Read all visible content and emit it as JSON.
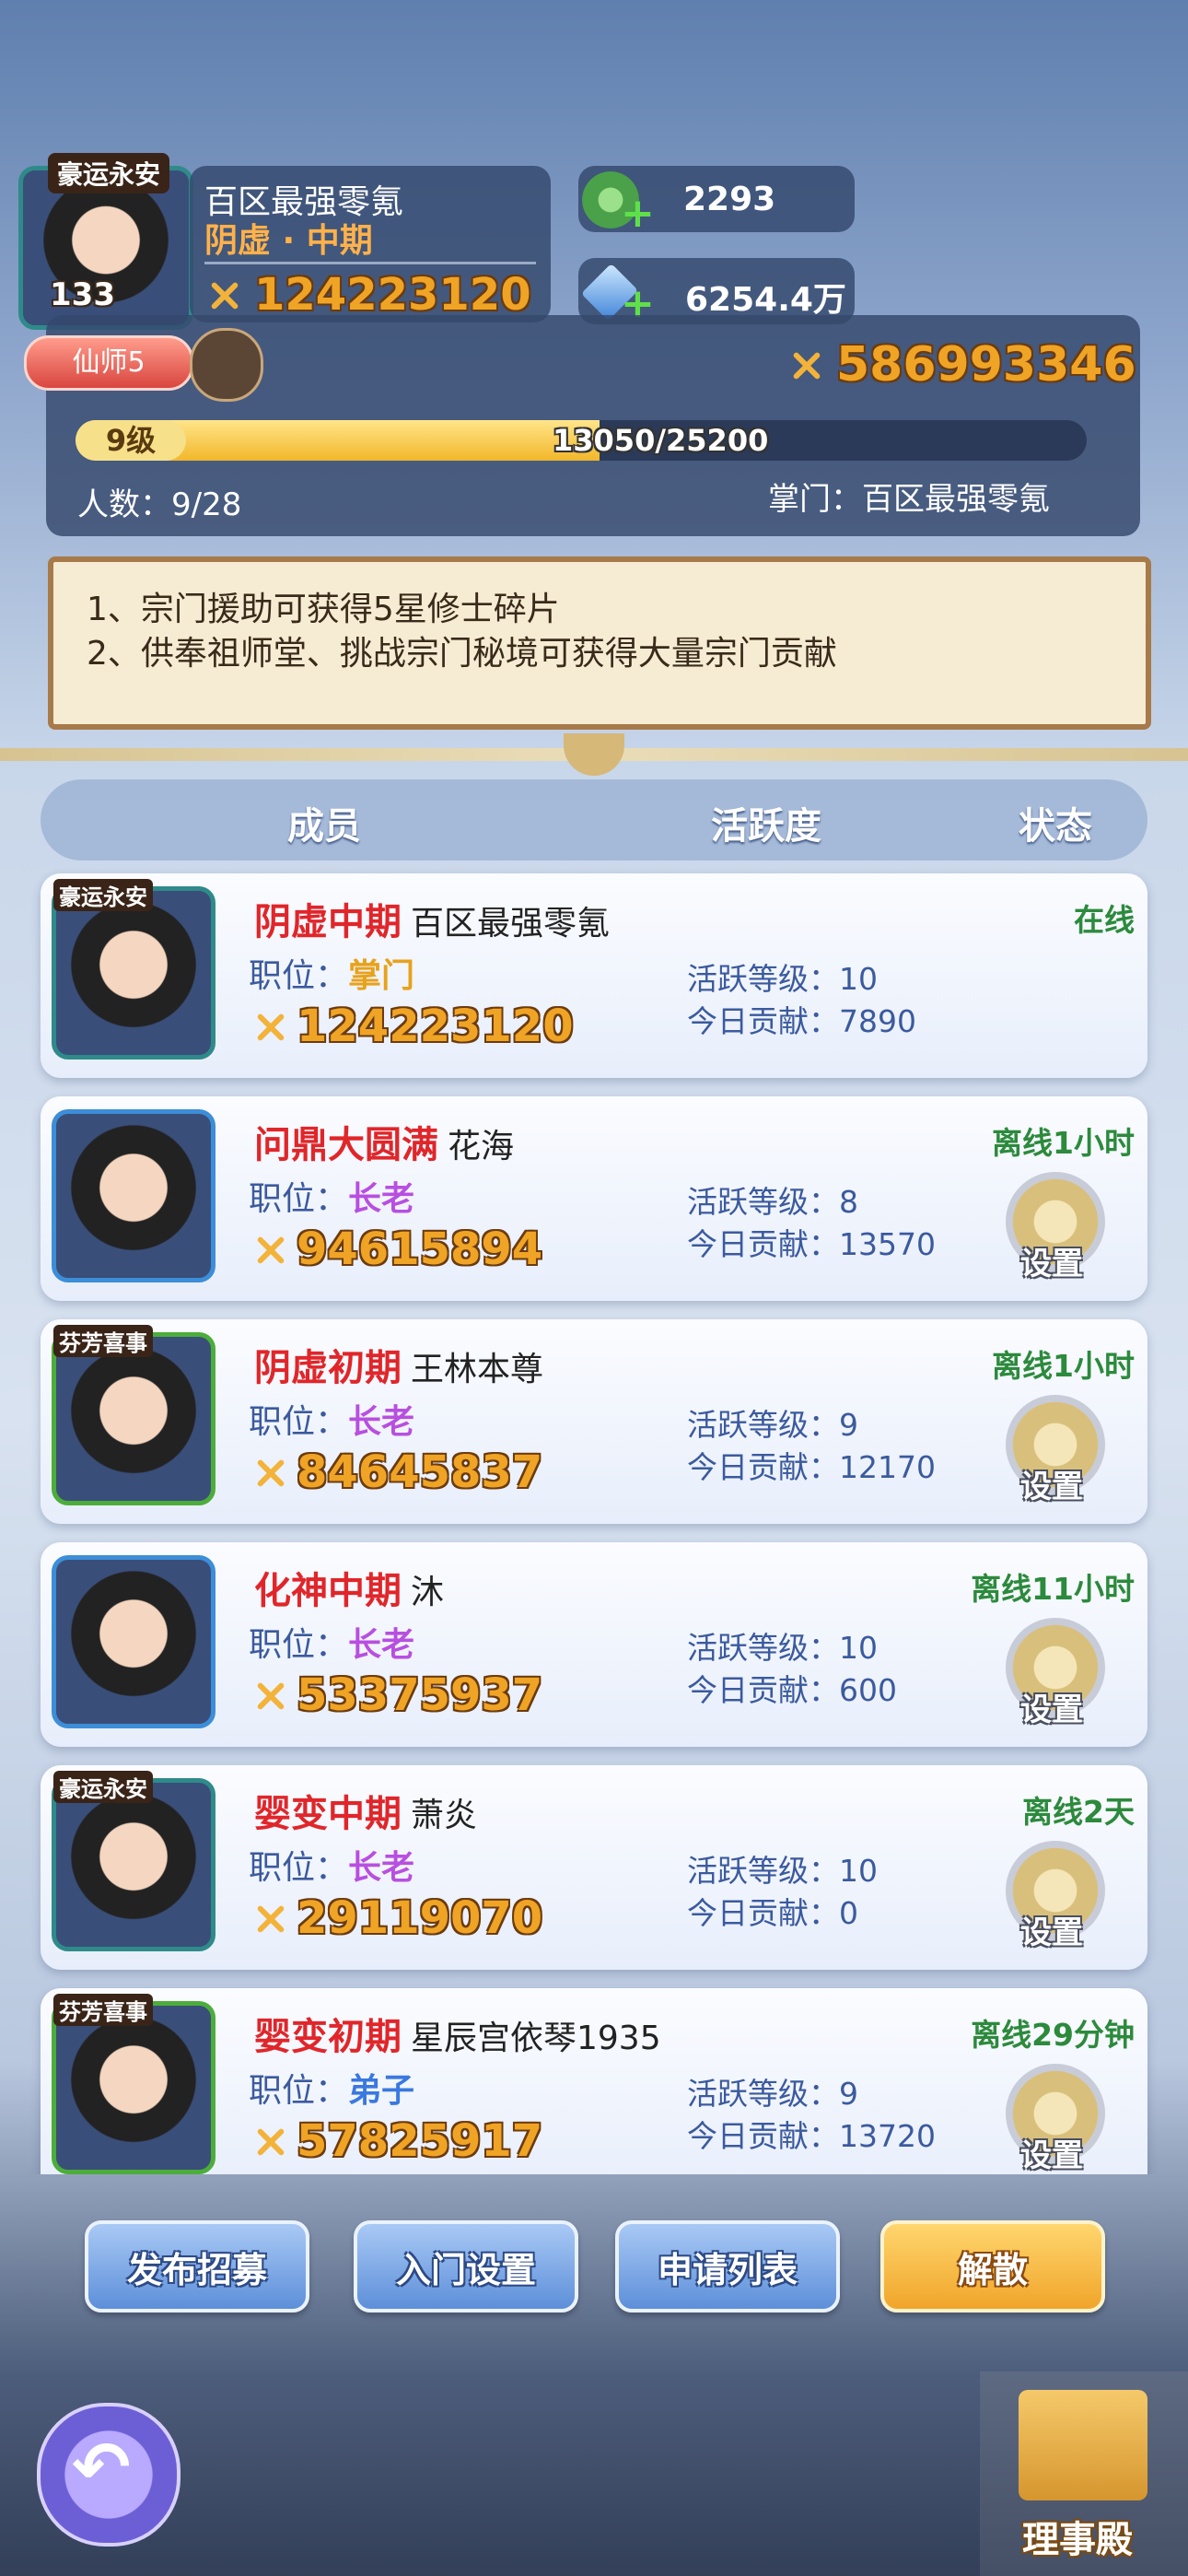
{
  "leader": {
    "level": "133",
    "name": "百区最强零氪",
    "realm": "阴虚 · 中期",
    "power": "124223120",
    "badge": "豪运永安",
    "title_tag": "仙师5"
  },
  "resources": {
    "jade": "2293",
    "crystal": "6254.4万"
  },
  "sect": {
    "total_power": "586993346",
    "level": "9级",
    "exp_text": "13050/25200",
    "exp_progress": 0.518,
    "members_text": "人数：9/28",
    "master_text": "掌门：百区最强零氪"
  },
  "notice": [
    "1、宗门援助可获得5星修士碎片",
    "2、供奉祖师堂、挑战宗门秘境可获得大量宗门贡献"
  ],
  "table_header": {
    "member": "成员",
    "activity": "活跃度",
    "status": "状态"
  },
  "labels": {
    "position": "职位：",
    "activity_level": "活跃等级：",
    "today_contrib": "今日贡献：",
    "settings": "设置"
  },
  "members": [
    {
      "realm": "阴虚中期",
      "name": "百区最强零氪",
      "position": "掌门",
      "position_color": "#e7a21c",
      "power": "124223120",
      "activity": "10",
      "contrib": "7890",
      "status": "在线",
      "badge": "豪运永安"
    },
    {
      "realm": "问鼎大圆满",
      "name": "花海",
      "position": "长老",
      "position_color": "#b84fe0",
      "power": "94615894",
      "activity": "8",
      "contrib": "13570",
      "status": "离线1小时",
      "badge": ""
    },
    {
      "realm": "阴虚初期",
      "name": "王林本尊",
      "position": "长老",
      "position_color": "#b84fe0",
      "power": "84645837",
      "activity": "9",
      "contrib": "12170",
      "status": "离线1小时",
      "badge": "芬芳喜事"
    },
    {
      "realm": "化神中期",
      "name": "沐",
      "position": "长老",
      "position_color": "#b84fe0",
      "power": "53375937",
      "activity": "10",
      "contrib": "600",
      "status": "离线11小时",
      "badge": ""
    },
    {
      "realm": "婴变中期",
      "name": "萧炎",
      "position": "长老",
      "position_color": "#b84fe0",
      "power": "29119070",
      "activity": "10",
      "contrib": "0",
      "status": "离线2天",
      "badge": "豪运永安"
    },
    {
      "realm": "婴变初期",
      "name": "星辰宫依琴1935",
      "position": "弟子",
      "position_color": "#3a78e0",
      "power": "57825917",
      "activity": "9",
      "contrib": "13720",
      "status": "离线29分钟",
      "badge": "芬芳喜事"
    }
  ],
  "buttons": {
    "recruit": "发布招募",
    "entry_settings": "入门设置",
    "apply_list": "申请列表",
    "dissolve": "解散"
  },
  "hall": {
    "label": "理事殿"
  }
}
